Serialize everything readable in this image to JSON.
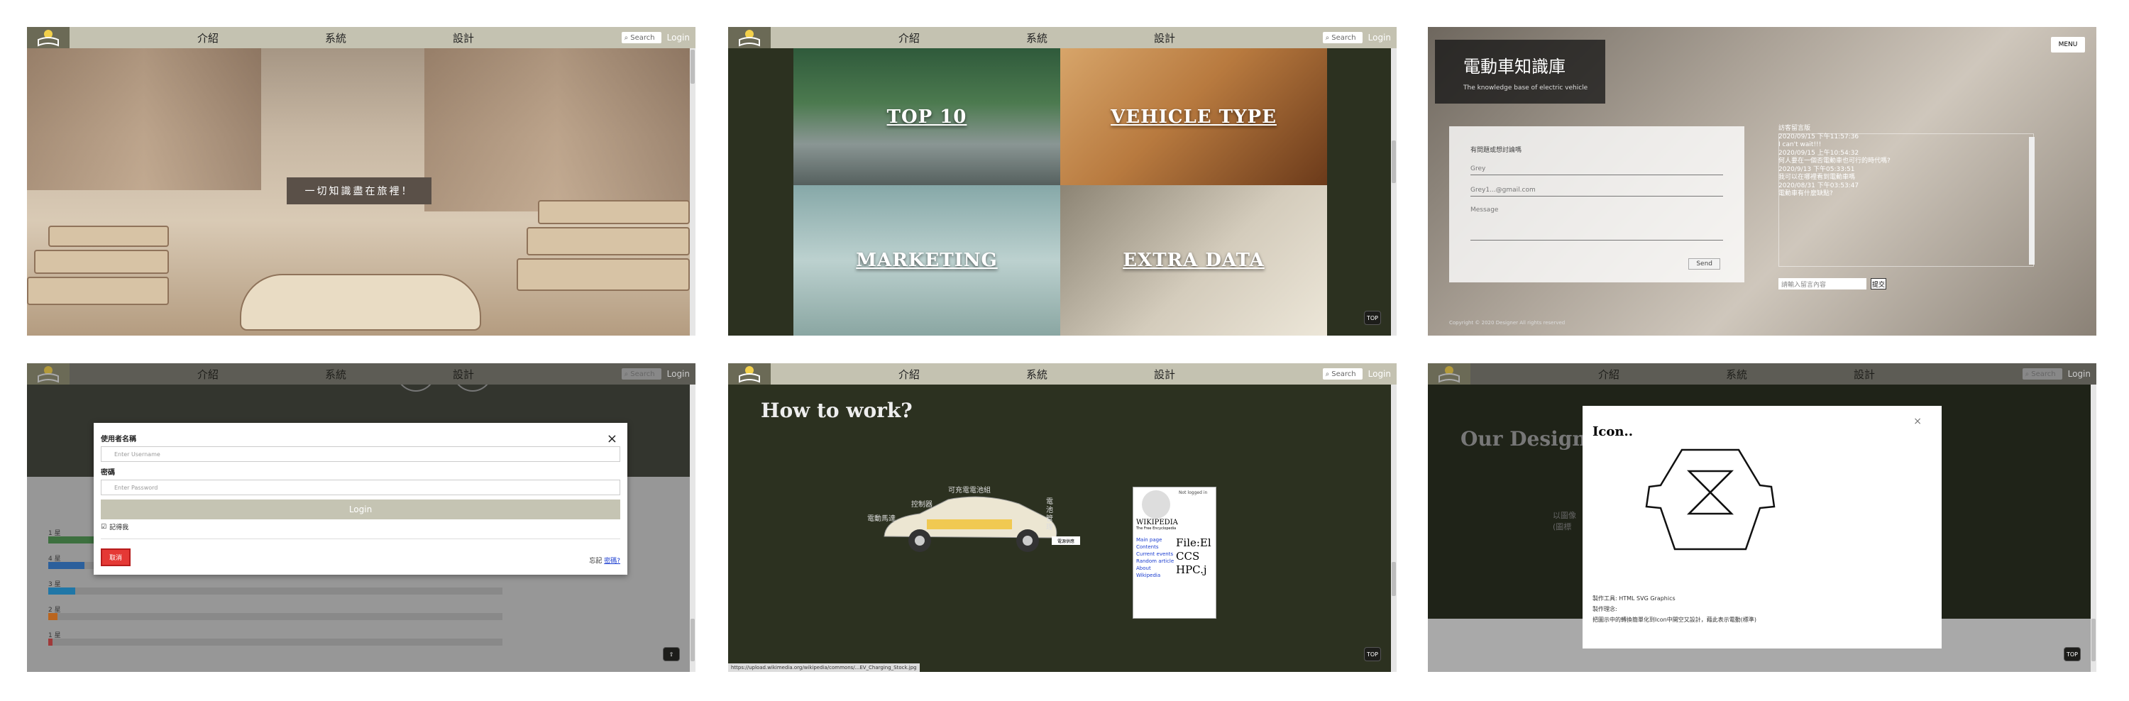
{
  "nav": {
    "links": [
      "介紹",
      "系統",
      "設計"
    ],
    "search_placeholder": "Search",
    "login_label": "Login"
  },
  "panel1": {
    "quote": "一切知識盡在旅裡！"
  },
  "panel2": {
    "tiles": [
      "TOP 10",
      "VEHICLE TYPE",
      "MARKETING",
      "EXTRA DATA"
    ],
    "top_label": "TOP"
  },
  "panel3": {
    "brand_title": "電動車知識庫",
    "brand_subtitle": "The knowledge base of electric vehicle",
    "menu_label": "MENU",
    "form_prompt": "有問題或想討論嗎",
    "name_value": "Grey",
    "email_value": "Grey1...@gmail.com",
    "message_placeholder": "Message",
    "send_label": "Send",
    "chat_lines": [
      "訪客留言版",
      "2020/09/15 下午11:57:36",
      "I can't wait!!!",
      "2020/09/15 上午10:54:32",
      "何人要在一個否電動車也可行的時代嗎?",
      "2020/9/13 下午05:33:51",
      "我可以在哪裡看到電動車嗎",
      "2020/08/31 下午03:53:47",
      "電動車有什麼缺點?"
    ],
    "message_input_placeholder": "請輸入留言內容",
    "submit_label": "提交",
    "footer": "Copyright © 2020 Designer All rights reserved"
  },
  "panel4": {
    "username_label": "使用者名稱",
    "username_placeholder": "Enter Username",
    "password_label": "密碼",
    "password_placeholder": "Enter Password",
    "login_button": "Login",
    "remember_label": "記得我",
    "cancel_label": "取消",
    "forgot_prefix": "忘記",
    "forgot_link": "密碼?",
    "bars": [
      {
        "label": "1 星",
        "fill": 0.1,
        "color": "#2e7d32"
      },
      {
        "label": "4 星",
        "fill": 0.08,
        "color": "#1565c0"
      },
      {
        "label": "3 星",
        "fill": 0.06,
        "color": "#0288d1"
      },
      {
        "label": "2 星",
        "fill": 0.02,
        "color": "#ef6c00"
      },
      {
        "label": "1 星",
        "fill": 0.01,
        "color": "#c62828"
      }
    ]
  },
  "panel5": {
    "title": "How to work?",
    "car_labels": [
      "電動馬達",
      "控制器",
      "可充電電池組",
      "電池管理"
    ],
    "tag": "電源供應",
    "wiki": {
      "name": "WIKIPEDIA",
      "tagline": "The Free Encyclopedia",
      "links": [
        "Main page",
        "Contents",
        "Current events",
        "Random article",
        "About Wikipedia"
      ],
      "big": [
        "File:El",
        "CCS",
        "HPC.j"
      ],
      "login": "Not logged in"
    },
    "status_url": "https://upload.wikimedia.org/wikipedia/commons/...EV_Charging_Stock.jpg",
    "top_label": "TOP"
  },
  "panel6": {
    "title": "Our Design",
    "bg_text_1": "以圖像",
    "bg_text_2": "(圖標",
    "icon_title": "Icon..",
    "close": "×",
    "made_with": "製作工具: HTML SVG Graphics",
    "concept_label": "製作理念:",
    "concept_text": "把圖示中的轉換簡單化到Icon中開空又設計，藉此表示電動(標準)",
    "top_label": "TOP"
  }
}
